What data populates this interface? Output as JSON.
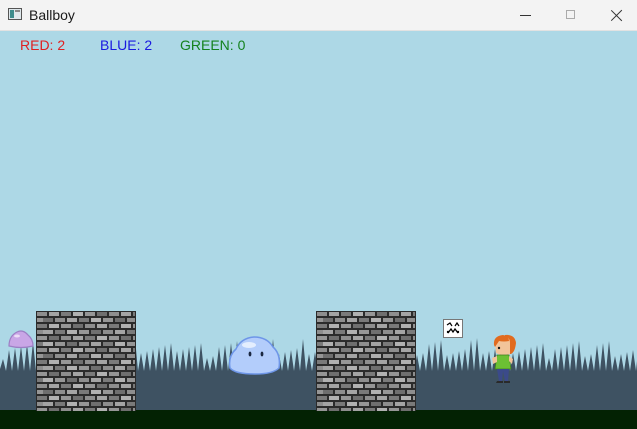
{
  "window": {
    "title": "Ballboy",
    "app_icon": "window-app-icon",
    "controls": [
      "minimize-icon",
      "maximize-icon",
      "close-icon"
    ]
  },
  "hud": {
    "red": {
      "label": "RED: 2",
      "value": 2,
      "color": "#e02020"
    },
    "blue": {
      "label": "BLUE: 2",
      "value": 2,
      "color": "#1a1ae0"
    },
    "green": {
      "label": "GREEN: 0",
      "value": 0,
      "color": "#13821d"
    }
  },
  "scene": {
    "sky_color": "#add8e6",
    "forest_color": "#3e5262",
    "ground_color": "#032203",
    "entities": [
      {
        "name": "slime-small",
        "color": "#c9a6e6"
      },
      {
        "name": "brick-wall"
      },
      {
        "name": "slime-big",
        "color": "#b3cdfb"
      },
      {
        "name": "brick-wall"
      },
      {
        "name": "broken-image-icon"
      },
      {
        "name": "ballboy-player"
      }
    ]
  }
}
